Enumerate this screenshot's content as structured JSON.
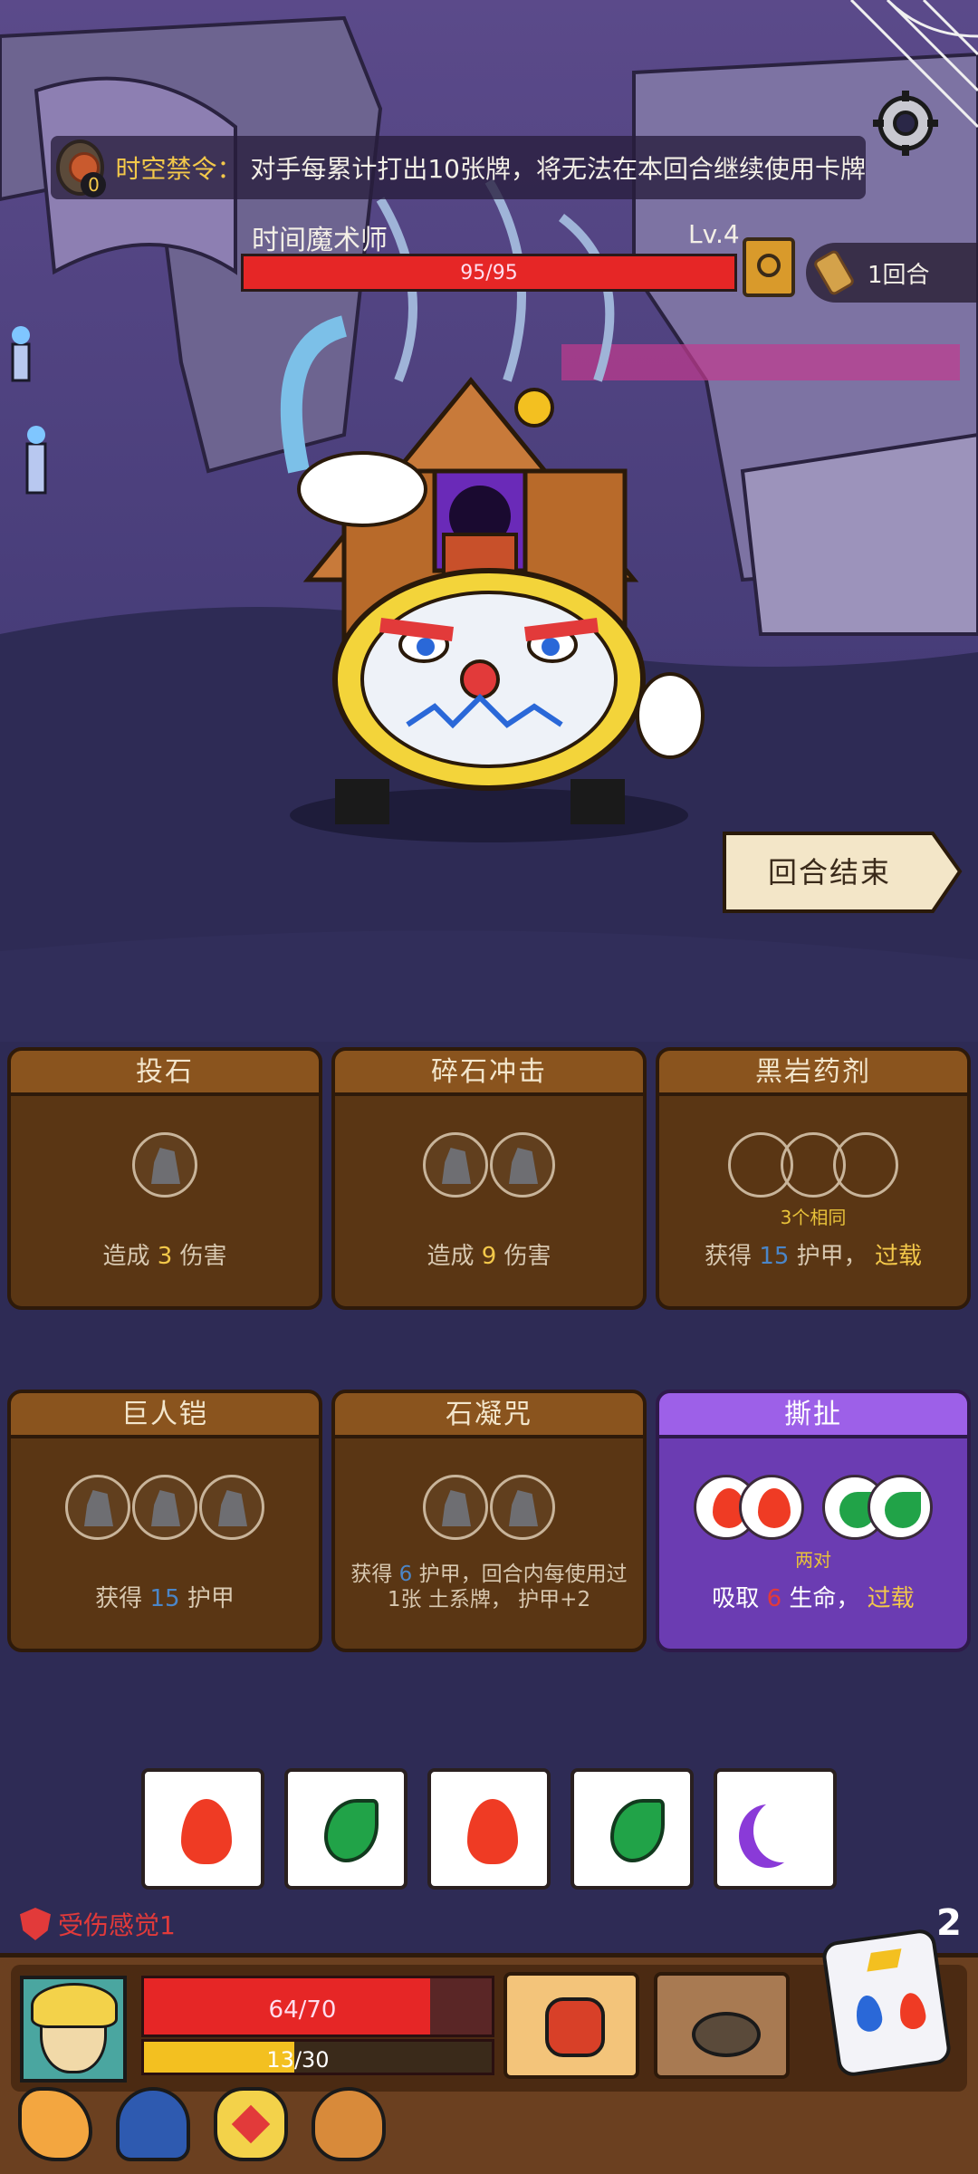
{
  "banner": {
    "counter": "0",
    "name": "时空禁令：",
    "description": "对手每累计打出10张牌，将无法在本回合继续使用卡牌"
  },
  "enemy": {
    "name": "时间魔术师",
    "level": "Lv.4",
    "hp_text": "95/95",
    "hp_fraction": 1.0
  },
  "round": {
    "text": "1回合"
  },
  "end_turn": {
    "label": "回合结束"
  },
  "cards": [
    {
      "title": "投石",
      "desc_prefix": "造成",
      "value": "3",
      "desc_suffix": "伤害"
    },
    {
      "title": "碎石冲击",
      "desc_prefix": "造成",
      "value": "9",
      "desc_suffix": "伤害"
    },
    {
      "title": "黑岩药剂",
      "hint": "3个相同",
      "desc_prefix": "获得",
      "value": "15",
      "desc_suffix": "护甲，",
      "keyword": "过载"
    },
    {
      "title": "巨人铠",
      "desc_prefix": "获得",
      "value": "15",
      "desc_suffix": "护甲"
    },
    {
      "title": "石凝咒",
      "desc": "获得",
      "value": "6",
      "desc_mid": "护甲，回合内每使用过1张",
      "desc_tail": "土系牌，",
      "desc_end": "护甲+2"
    },
    {
      "title": "撕扯",
      "hint": "两对",
      "desc_prefix": "吸取",
      "value": "6",
      "desc_suffix": "生命，",
      "keyword": "过载"
    }
  ],
  "dice_pool": [
    "fire",
    "leaf",
    "fire",
    "leaf",
    "moon"
  ],
  "player": {
    "status": "受伤感觉1",
    "hp_text": "64/70",
    "hp_fraction": 0.914,
    "xp_text": "13/30",
    "xp_fraction": 0.433,
    "dice_count": "2"
  },
  "relics": [
    "hand-relic-icon",
    "cloak-relic-icon",
    "heart-relic-icon",
    "pot-relic-icon"
  ],
  "colors": {
    "enemy_hp": "#e62626",
    "player_hp": "#e62626",
    "xp": "#f3c020",
    "card_brown": "#5a3614",
    "card_purple": "#6b3cb2"
  }
}
